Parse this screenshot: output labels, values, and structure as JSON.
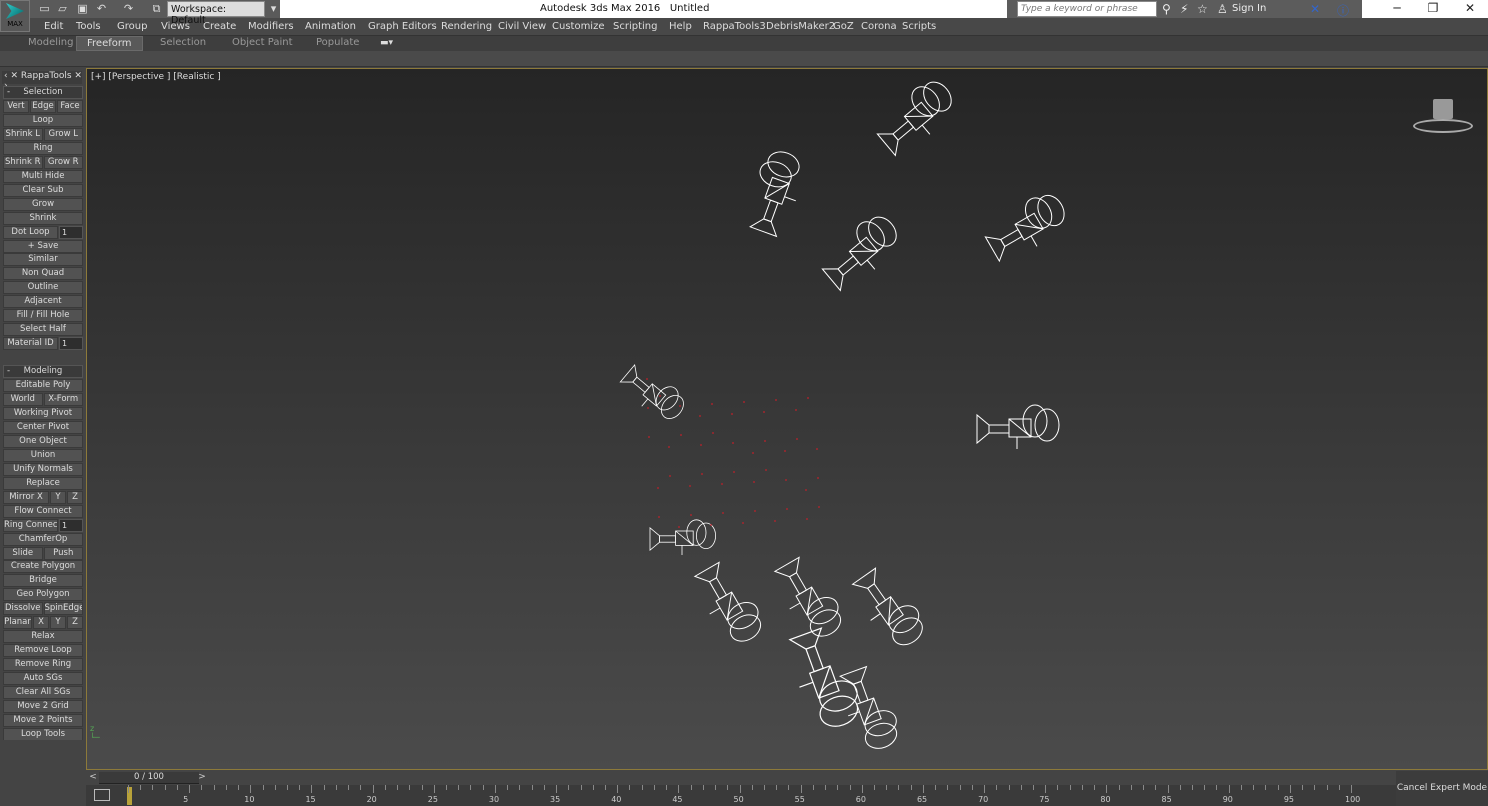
{
  "title": {
    "app": "Autodesk 3ds Max 2016",
    "doc": "Untitled",
    "logo_text": "MAX",
    "workspace": "Workspace: Default"
  },
  "search": {
    "placeholder": "Type a keyword or phrase",
    "signin": "Sign In"
  },
  "menu": [
    "Edit",
    "Tools",
    "Group",
    "Views",
    "Create",
    "Modifiers",
    "Animation",
    "Graph Editors",
    "Rendering",
    "Civil View",
    "Customize",
    "Scripting",
    "Help",
    "RappaTools3",
    "DebrisMaker2",
    "GoZ",
    "Corona",
    "Scripts"
  ],
  "ribbon_tabs": [
    "Modeling",
    "Freeform",
    "Selection",
    "Object Paint",
    "Populate"
  ],
  "ribbon_active": "Freeform",
  "panel": {
    "title": "RappaTools",
    "rows": [
      {
        "h": "Selection"
      },
      {
        "b": [
          "Vert",
          "Edge",
          "Face"
        ]
      },
      {
        "b": [
          "Loop"
        ]
      },
      {
        "b": [
          "Shrink L",
          "Grow L"
        ]
      },
      {
        "b": [
          "Ring"
        ]
      },
      {
        "b": [
          "Shrink R",
          "Grow R"
        ]
      },
      {
        "b": [
          "Multi Hide"
        ]
      },
      {
        "b": [
          "Clear Sub"
        ]
      },
      {
        "b": [
          "Grow"
        ]
      },
      {
        "b": [
          "Shrink"
        ]
      },
      {
        "b": [
          "Dot Loop"
        ],
        "s": "1"
      },
      {
        "b": [
          "+ Save"
        ]
      },
      {
        "b": [
          "Similar"
        ]
      },
      {
        "b": [
          "Non Quad"
        ]
      },
      {
        "b": [
          "Outline"
        ]
      },
      {
        "b": [
          "Adjacent"
        ]
      },
      {
        "b": [
          "Fill / Fill Hole"
        ]
      },
      {
        "b": [
          "Select Half"
        ]
      },
      {
        "b": [
          "Material ID"
        ],
        "s": "1"
      },
      {
        "gap": true
      },
      {
        "h": "Modeling"
      },
      {
        "b": [
          "Editable Poly"
        ]
      },
      {
        "b": [
          "World",
          "X-Form"
        ]
      },
      {
        "b": [
          "Working Pivot"
        ]
      },
      {
        "b": [
          "Center Pivot"
        ]
      },
      {
        "b": [
          "One Object"
        ]
      },
      {
        "b": [
          "Union"
        ]
      },
      {
        "b": [
          "Unify Normals"
        ]
      },
      {
        "b": [
          "Replace"
        ]
      },
      {
        "b": [
          "Mirror X",
          "Y",
          "Z"
        ]
      },
      {
        "b": [
          "Flow Connect"
        ]
      },
      {
        "b": [
          "Ring Connect"
        ],
        "s": "1"
      },
      {
        "b": [
          "ChamferOp"
        ]
      },
      {
        "b": [
          "Slide",
          "Push"
        ]
      },
      {
        "b": [
          "Create Polygon"
        ]
      },
      {
        "b": [
          "Bridge"
        ]
      },
      {
        "b": [
          "Geo Polygon"
        ]
      },
      {
        "b": [
          "Dissolve",
          "SpinEdge"
        ]
      },
      {
        "b": [
          "Planar",
          "X",
          "Y",
          "Z"
        ]
      },
      {
        "b": [
          "Relax"
        ]
      },
      {
        "b": [
          "Remove Loop"
        ]
      },
      {
        "b": [
          "Remove Ring"
        ]
      },
      {
        "b": [
          "Auto SGs"
        ]
      },
      {
        "b": [
          "Clear All SGs"
        ]
      },
      {
        "b": [
          "Move 2 Grid"
        ]
      },
      {
        "b": [
          "Move 2 Points"
        ]
      },
      {
        "b": [
          "Loop Tools"
        ]
      }
    ]
  },
  "viewport": {
    "label": "[+] [Perspective ] [Realistic ]"
  },
  "timeline": {
    "frame": "0 / 100",
    "start": 0,
    "end": 100,
    "label_step": 5,
    "current": 0
  },
  "expert": {
    "label": "Cancel Expert Mode"
  },
  "colors": {
    "border": "#8d7a3a",
    "wire": "#ffffff",
    "particles": "#c0202a"
  }
}
